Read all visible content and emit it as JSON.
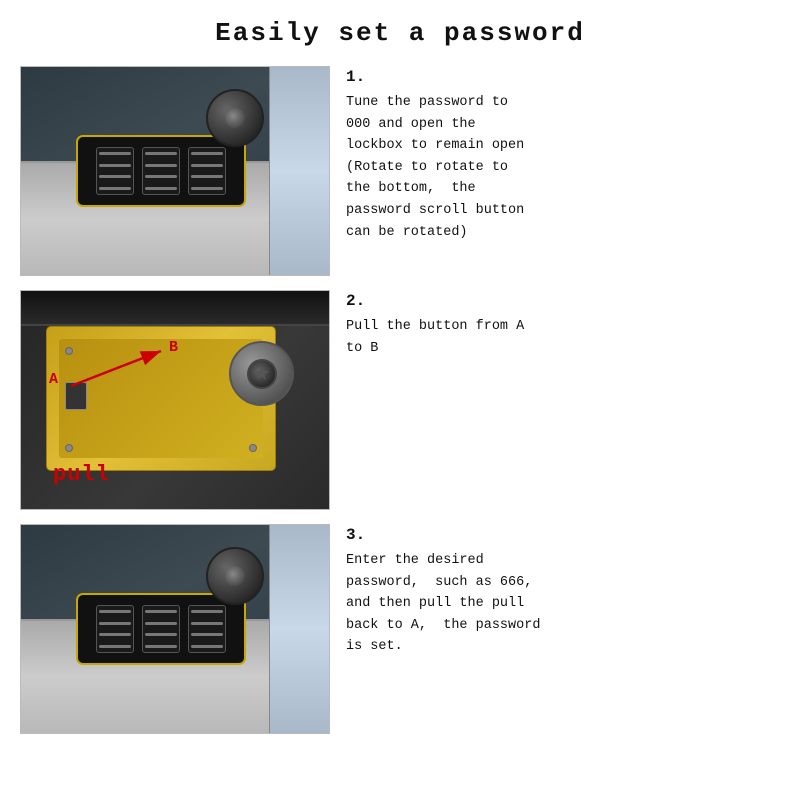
{
  "title": "Easily set a password",
  "steps": [
    {
      "number": "1.",
      "description": "Tune the password to\n000 and open the\nlockbox to remain open\n(Rotate to rotate to\nthe bottom,  the\npassword scroll button\ncan be rotated)"
    },
    {
      "number": "2.",
      "description": "Pull the button from A\nto B"
    },
    {
      "number": "3.",
      "description": "Enter the desired\npassword,  such as 666,\nand then pull the pull\nback to A,  the password\nis set."
    }
  ],
  "labels": {
    "pull": "pull",
    "a": "A",
    "b": "B"
  }
}
